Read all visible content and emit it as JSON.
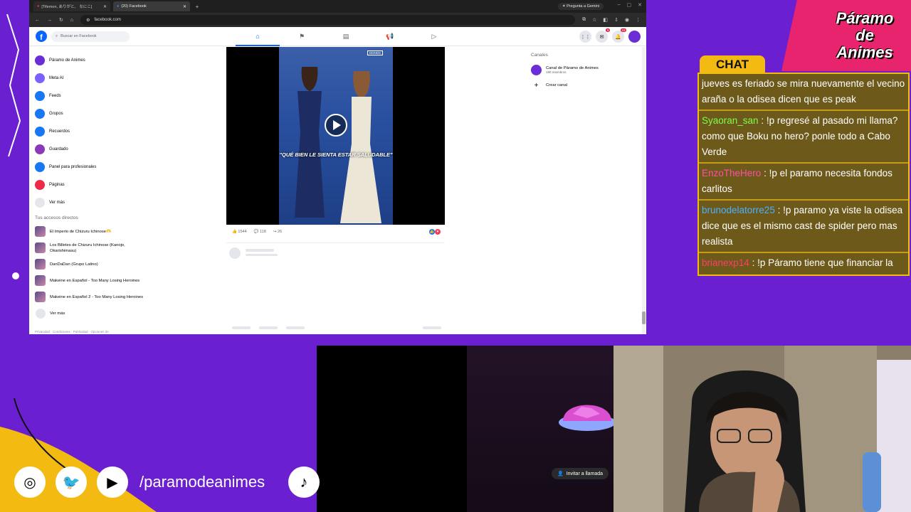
{
  "browser": {
    "tabs": [
      {
        "label": "[Tifemon, ありがと、 なにこ]",
        "active": false
      },
      {
        "label": "(20) Facebook",
        "active": true
      }
    ],
    "gemini_button": "Pregunta a Gemini",
    "url": "facebook.com"
  },
  "facebook": {
    "search_placeholder": "Buscar en Facebook",
    "badges": {
      "messenger": "5",
      "notifications": "15"
    },
    "left_menu": [
      {
        "label": "Páramo de Animes",
        "icon": "profile-avatar",
        "color": "#6b2dd6"
      },
      {
        "label": "Meta AI",
        "icon": "meta-ai-icon",
        "color": "#7b61ff"
      },
      {
        "label": "Feeds",
        "icon": "feeds-icon",
        "color": "#1877f2"
      },
      {
        "label": "Grupos",
        "icon": "groups-icon",
        "color": "#1877f2"
      },
      {
        "label": "Recuerdos",
        "icon": "memories-icon",
        "color": "#1877f2"
      },
      {
        "label": "Guardado",
        "icon": "saved-icon",
        "color": "#8a3ab9"
      },
      {
        "label": "Panel para profesionales",
        "icon": "dashboard-icon",
        "color": "#1877f2"
      },
      {
        "label": "Páginas",
        "icon": "pages-flag-icon",
        "color": "#f02849"
      },
      {
        "label": "Ver más",
        "icon": "chevron-down-icon",
        "color": "#e4e6eb"
      }
    ],
    "shortcuts_title": "Tus accesos directos",
    "shortcuts": [
      {
        "label": "El Imperio de Chizuru Ichinose🫶"
      },
      {
        "label": "Los Billetes de Chizuru Ichinose (Kanojo, Okarishimasu)"
      },
      {
        "label": "DanDaDan (Grupo Latino)"
      },
      {
        "label": "Makeine en Español - Too Many Losing Heroines"
      },
      {
        "label": "Makeine en Español 2 - Too Many Losing Heroines"
      },
      {
        "label": "Ver más"
      }
    ],
    "footer": "Privacidad · Condiciones · Publicidad · Opciones de",
    "post": {
      "caption": "\"QUÉ BIEN LE SIENTA ESTAR SALUDABLE\"",
      "likes": "1544",
      "comments": "118",
      "shares": "26"
    },
    "channels_title": "Canales",
    "channels": [
      {
        "name": "Canal de Páramo de Animes",
        "members": "190 miembros"
      },
      {
        "name": "Crear canal",
        "members": ""
      }
    ]
  },
  "chat": {
    "title": "CHAT",
    "messages": [
      {
        "user": "",
        "user_color": "#ffffff",
        "text": "jueves es feriado se mira nuevamente el vecino araña o la odisea dicen que es peak"
      },
      {
        "user": "Syaoran_san",
        "user_color": "#7cff4a",
        "text": ": !p regresé al pasado mi llama? como que Boku no hero? ponle todo a Cabo Verde"
      },
      {
        "user": "EnzoTheHero",
        "user_color": "#ff4fa3",
        "text": ": !p el paramo necesita fondos carlitos"
      },
      {
        "user": "brunodelatorre25",
        "user_color": "#4ab0ff",
        "text": ": !p paramo ya viste la odisea dice que es el mismo cast de spider pero mas realista"
      },
      {
        "user": "brianexp14",
        "user_color": "#ff3d6a",
        "text": ": !p Páramo tiene que financiar la entrada de la araña"
      }
    ]
  },
  "brand": {
    "line1": "Páramo",
    "line2": "de",
    "line3": "Animes"
  },
  "call": {
    "invite_label": "Invitar a llamada"
  },
  "socials": {
    "handle": "/paramodeanimes"
  }
}
